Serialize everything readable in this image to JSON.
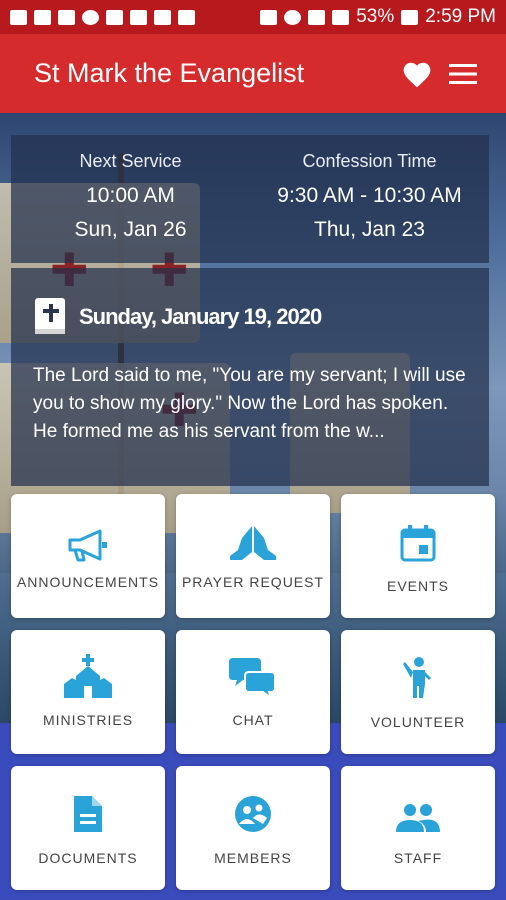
{
  "status_bar": {
    "battery": "53%",
    "time": "2:59 PM"
  },
  "app_bar": {
    "title": "St Mark the Evangelist",
    "favorite_icon": "heart-icon",
    "menu_icon": "menu-icon"
  },
  "service": {
    "next": {
      "label": "Next Service",
      "time": "10:00 AM",
      "date": "Sun, Jan 26"
    },
    "confession": {
      "label": "Confession Time",
      "time": "9:30 AM - 10:30 AM",
      "date": "Thu, Jan 23"
    }
  },
  "reading": {
    "icon": "bible-icon",
    "date": "Sunday, January 19, 2020",
    "text": "The Lord said to me, \"You are my servant; I will use you to show my glory.\" Now the Lord has spoken. He formed me as his servant from the w..."
  },
  "tiles": [
    {
      "label": "ANNOUNCEMENTS",
      "icon": "megaphone-icon"
    },
    {
      "label": "PRAYER REQUEST",
      "icon": "praying-hands-icon"
    },
    {
      "label": "EVENTS",
      "icon": "calendar-icon"
    },
    {
      "label": "MINISTRIES",
      "icon": "church-icon"
    },
    {
      "label": "CHAT",
      "icon": "chat-icon"
    },
    {
      "label": "VOLUNTEER",
      "icon": "volunteer-icon"
    },
    {
      "label": "DOCUMENTS",
      "icon": "document-icon"
    },
    {
      "label": "MEMBERS",
      "icon": "members-icon"
    },
    {
      "label": "STAFF",
      "icon": "staff-icon"
    }
  ],
  "colors": {
    "status_bar": "#b8191d",
    "app_bar": "#d52b2d",
    "icon_accent": "#29a3d8",
    "bottom_background": "#3a4cbc"
  }
}
